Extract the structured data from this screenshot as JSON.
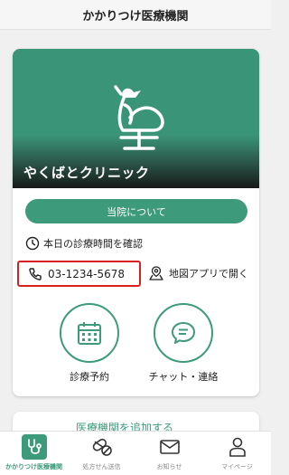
{
  "header": {
    "title": "かかりつけ医療機関"
  },
  "clinic": {
    "name": "やくばとクリニック",
    "about_label": "当院について",
    "hours_label": "本日の診療時間を確認",
    "phone": "03-1234-5678",
    "map_label": "地図アプリで開く"
  },
  "actions": {
    "reservation_label": "診療予約",
    "chat_label": "チャット・連絡"
  },
  "add_card": {
    "label": "医療機関を追加する"
  },
  "tabbar": {
    "items": [
      {
        "label": "かかりつけ医療機関",
        "icon": "stethoscope-icon",
        "active": true
      },
      {
        "label": "処方せん送信",
        "icon": "pills-icon",
        "active": false
      },
      {
        "label": "お知らせ",
        "icon": "envelope-icon",
        "active": false
      },
      {
        "label": "マイページ",
        "icon": "person-icon",
        "active": false
      }
    ]
  },
  "colors": {
    "accent": "#3d9a7b",
    "highlight_border": "#d92020"
  }
}
